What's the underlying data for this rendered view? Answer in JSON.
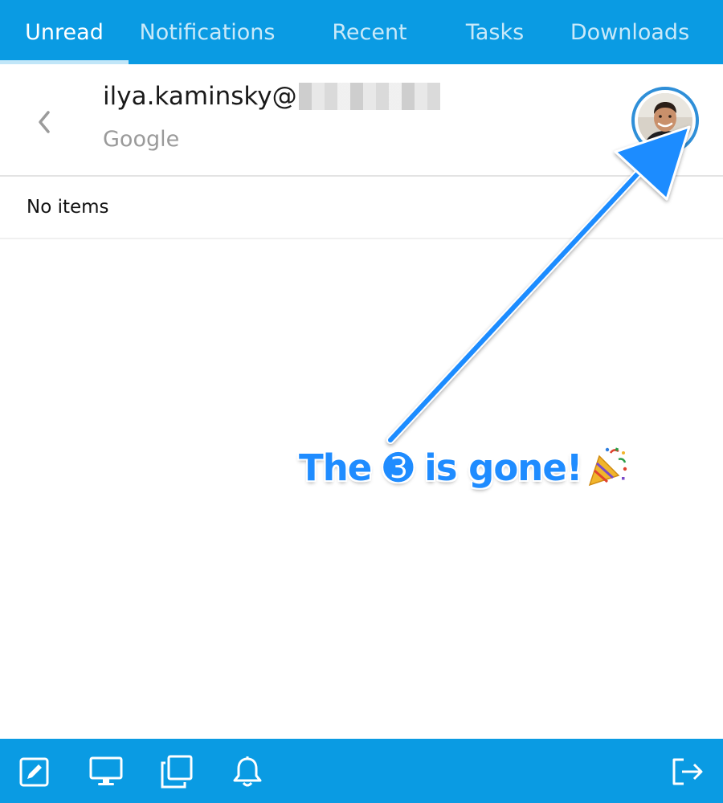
{
  "tabs": [
    {
      "label": "Unread",
      "active": true
    },
    {
      "label": "Notifications",
      "active": false
    },
    {
      "label": "Recent",
      "active": false
    },
    {
      "label": "Tasks",
      "active": false
    },
    {
      "label": "Downloads",
      "active": false
    }
  ],
  "account": {
    "email_prefix": "ilya.kaminsky@",
    "provider": "Google",
    "back_icon": "chevron-left-icon",
    "avatar": "user-avatar"
  },
  "list": {
    "empty_text": "No items"
  },
  "annotation": {
    "text": "The ➌ is gone!",
    "emoji_icon": "party-popper-icon",
    "color": "#1f8cff"
  },
  "toolbar": {
    "icons": [
      "compose-icon",
      "desktop-icon",
      "copy-windows-icon",
      "bell-icon",
      "sign-out-icon"
    ]
  },
  "colors": {
    "accent": "#0a9be3",
    "avatar_ring": "#2f8fd8"
  }
}
